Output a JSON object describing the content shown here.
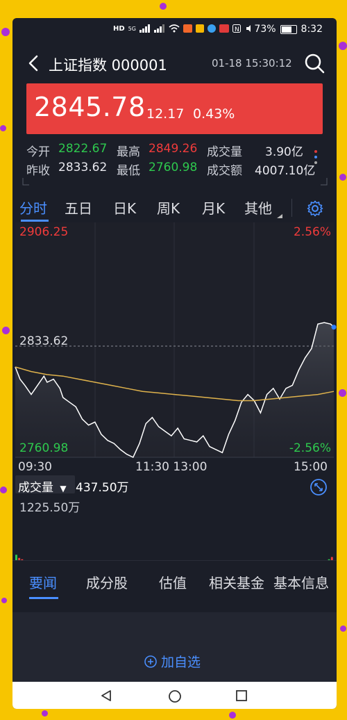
{
  "statusbar": {
    "network_labels": [
      "HD",
      "5G"
    ],
    "battery": "73%",
    "time": "8:32"
  },
  "header": {
    "title": "上证指数 000001",
    "datetime": "01-18 15:30:12"
  },
  "quote": {
    "price": "2845.78",
    "change": "12.17",
    "change_pct": "0.43%"
  },
  "stats": {
    "open_label": "今开",
    "open": "2822.67",
    "high_label": "最高",
    "high": "2849.26",
    "volume_label": "成交量",
    "volume": "3.90亿",
    "prev_close_label": "昨收",
    "prev_close": "2833.62",
    "low_label": "最低",
    "low": "2760.98",
    "turnover_label": "成交额",
    "turnover": "4007.10亿"
  },
  "period_tabs": [
    "分时",
    "五日",
    "日K",
    "周K",
    "月K",
    "其他"
  ],
  "colors": {
    "up": "#f03b3b",
    "down": "#2ec94e",
    "accent": "#4a8fff",
    "price_bg": "#e8403e",
    "avg_line": "#e0b34c"
  },
  "chart_data": {
    "type": "line",
    "title": "",
    "x_tick_labels": [
      "09:30",
      "11:30 13:00",
      "15:00"
    ],
    "ylim": [
      2760.98,
      2906.25
    ],
    "y_tick_labels": {
      "top": "2906.25",
      "mid": "2833.62",
      "bottom": "2760.98"
    },
    "pct_tick_labels": {
      "top": "2.56%",
      "bottom": "-2.56%"
    },
    "baseline": 2833.62,
    "series": [
      {
        "x": [
          0,
          1.5,
          3,
          5,
          7,
          9,
          10,
          12,
          14,
          15,
          17,
          19,
          21,
          23,
          25,
          27,
          29,
          31,
          33,
          35,
          37,
          39,
          41,
          43,
          45,
          47,
          49,
          51,
          53,
          55,
          57,
          59,
          61,
          63,
          65,
          67,
          69,
          71,
          73,
          75,
          77,
          79,
          81,
          83,
          85,
          87,
          89,
          91,
          93,
          95,
          97,
          99,
          100
        ],
        "values": [
          2820,
          2812,
          2808,
          2802,
          2808,
          2814,
          2810,
          2812,
          2806,
          2800,
          2797,
          2794,
          2786,
          2782,
          2784,
          2776,
          2772,
          2770,
          2766,
          2763,
          2761,
          2770,
          2783,
          2787,
          2781,
          2778,
          2775,
          2780,
          2773,
          2772,
          2771,
          2775,
          2768,
          2766,
          2764,
          2776,
          2785,
          2797,
          2802,
          2798,
          2790,
          2802,
          2806,
          2799,
          2806,
          2808,
          2818,
          2826,
          2832,
          2848,
          2849,
          2848,
          2846
        ]
      },
      {
        "x": [
          0,
          5,
          10,
          15,
          20,
          25,
          30,
          35,
          40,
          45,
          50,
          55,
          60,
          65,
          70,
          75,
          80,
          85,
          90,
          95,
          100
        ],
        "values": [
          2820,
          2817,
          2815,
          2814,
          2812,
          2810,
          2808,
          2806,
          2804,
          2803,
          2802,
          2801,
          2800,
          2799,
          2798,
          2798,
          2799,
          2800,
          2801,
          2802,
          2804
        ]
      }
    ]
  },
  "volume": {
    "label": "成交量",
    "current": "437.50万",
    "max_label": "1225.50万",
    "bars": [
      0.35,
      0.28,
      0.25,
      0.22,
      0.18,
      0.2,
      0.15,
      0.14,
      0.16,
      0.13,
      0.12,
      0.15,
      0.11,
      0.13,
      0.1,
      0.12,
      0.1,
      0.11,
      0.09,
      0.12,
      0.1,
      0.09,
      0.11,
      0.08,
      0.1,
      0.12,
      0.09,
      0.1,
      0.08,
      0.09,
      0.11,
      0.1,
      0.08,
      0.09,
      0.1,
      0.08,
      0.09,
      0.12,
      0.1,
      0.08,
      0.09,
      0.07,
      0.1,
      0.09,
      0.11,
      0.08,
      0.1,
      0.09,
      0.08,
      0.1,
      0.07,
      0.09,
      0.08,
      0.1,
      0.08,
      0.09,
      0.07,
      0.08,
      0.1,
      0.09,
      0.08,
      0.07,
      0.09,
      0.1,
      0.08,
      0.09,
      0.07,
      0.08,
      0.09,
      0.1,
      0.08,
      0.07,
      0.09,
      0.08,
      0.1,
      0.09,
      0.08,
      0.07,
      0.09,
      0.08,
      0.1,
      0.09,
      0.11,
      0.08,
      0.1,
      0.09,
      0.12,
      0.1,
      0.11,
      0.09,
      0.1,
      0.12,
      0.11,
      0.1,
      0.12,
      0.13,
      0.11,
      0.12,
      0.14,
      0.13,
      0.12,
      0.15,
      0.14,
      0.16,
      0.15,
      0.18,
      0.2,
      0.22,
      0.25,
      0.3
    ]
  },
  "news_tabs": [
    "要闻",
    "成分股",
    "估值",
    "相关基金",
    "基本信息"
  ],
  "add_watchlist": "加自选"
}
